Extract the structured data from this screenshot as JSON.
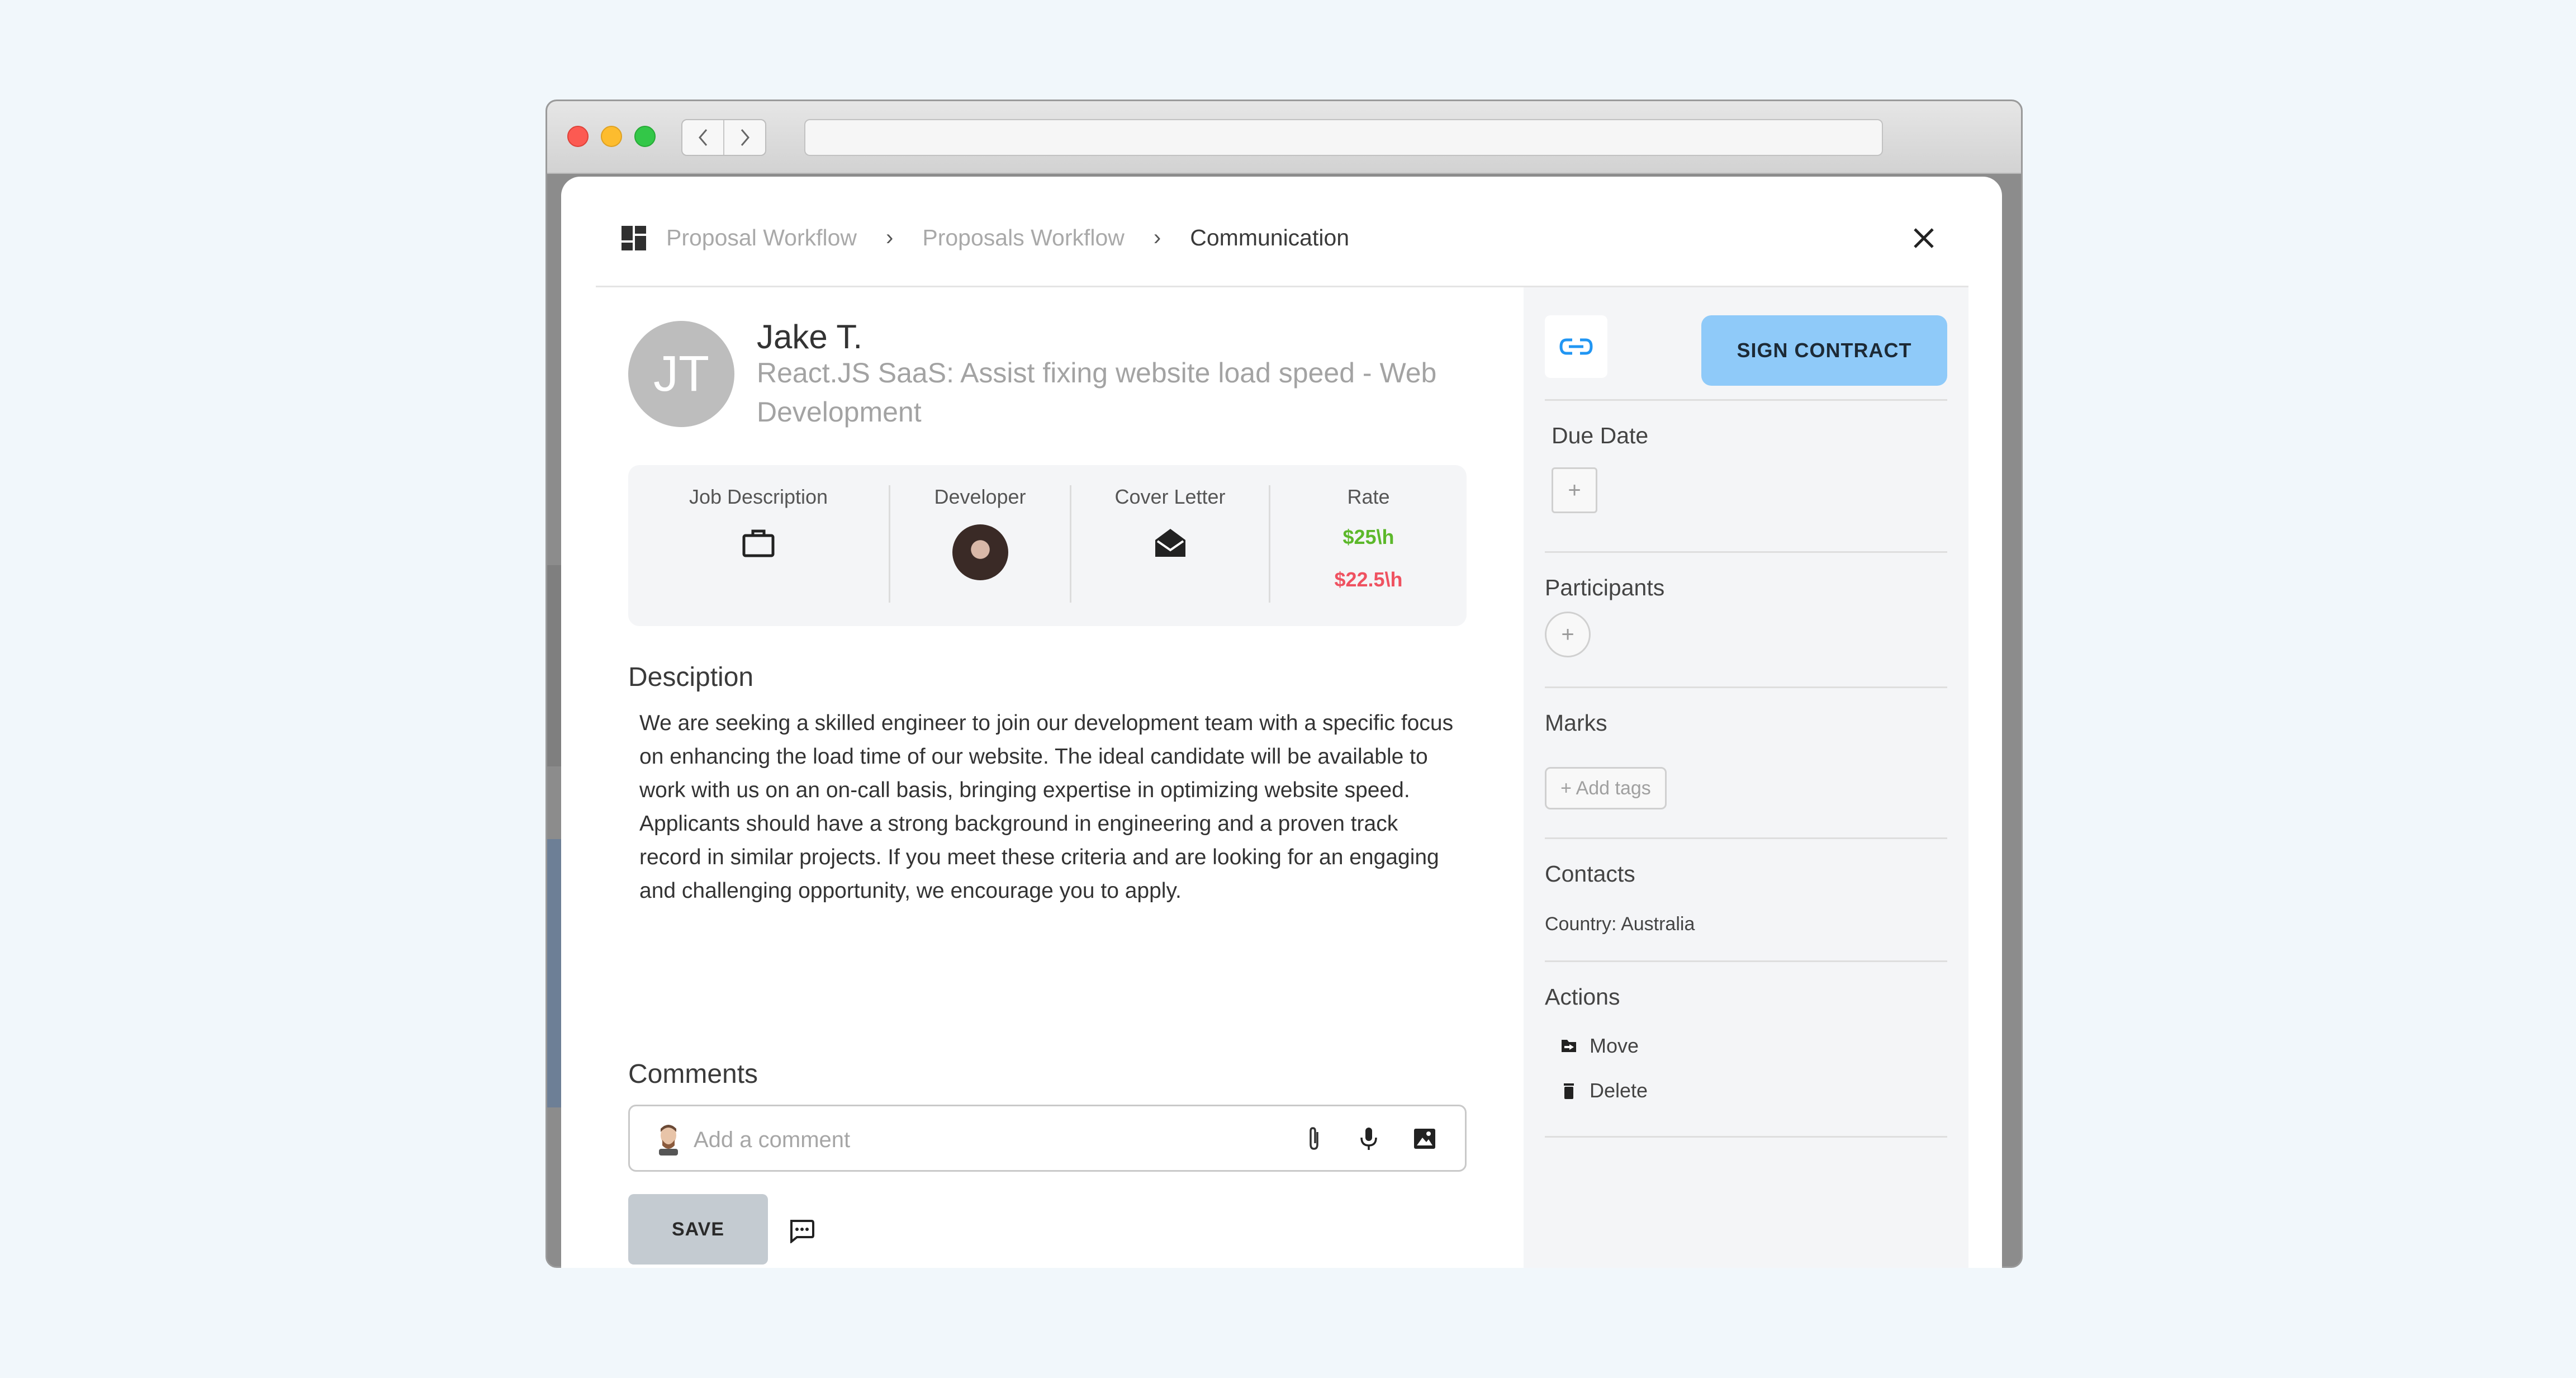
{
  "breadcrumb": {
    "items": [
      "Proposal Workflow",
      "Proposals Workflow"
    ],
    "current": "Communication",
    "separator": "›"
  },
  "candidate": {
    "initials": "JT",
    "name": "Jake T.",
    "job_title": "React.JS SaaS: Assist fixing website load speed - Web Development"
  },
  "info": {
    "job_description_label": "Job Description",
    "developer_label": "Developer",
    "cover_letter_label": "Cover Letter",
    "rate_label": "Rate",
    "rate_primary": "$25\\h",
    "rate_secondary": "$22.5\\h"
  },
  "description": {
    "title": "Desciption",
    "text": "We are seeking a skilled engineer to join our development team with a specific focus on enhancing the load time of our website. The ideal candidate will be available to work with us on an on-call basis, bringing expertise in optimizing website speed. Applicants should have a strong background in engineering and a proven track record in similar projects. If you meet these criteria and are looking for an engaging and challenging opportunity, we encourage you to apply."
  },
  "comments": {
    "title": "Comments",
    "placeholder": "Add a comment",
    "save_label": "SAVE"
  },
  "sidebar": {
    "sign_label": "SIGN CONTRACT",
    "due_date_title": "Due Date",
    "participants_title": "Participants",
    "marks_title": "Marks",
    "add_tags_label": "+ Add tags",
    "contacts_title": "Contacts",
    "country": "Country: Australia",
    "actions_title": "Actions",
    "move_label": "Move",
    "delete_label": "Delete",
    "add_symbol": "+"
  },
  "colors": {
    "rate_primary": "#5cb82b",
    "rate_secondary": "#ef5261",
    "accent": "#8fcaf9"
  }
}
